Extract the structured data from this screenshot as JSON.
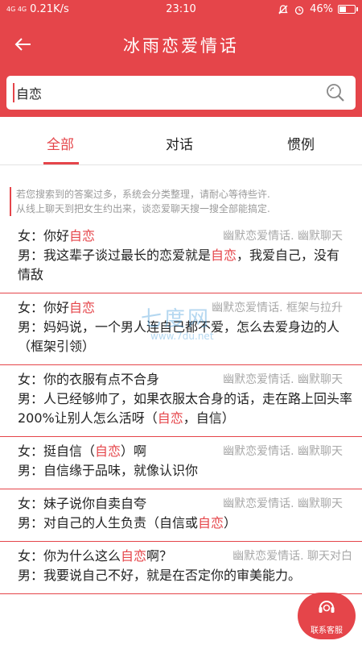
{
  "status_bar": {
    "signal": "4G 4G",
    "speed": "0.21K/s",
    "time": "23:10",
    "battery": "46%",
    "battery_level": 0.46
  },
  "header": {
    "title": "冰雨恋爱情话"
  },
  "search": {
    "value": "自恋"
  },
  "tabs": [
    {
      "label": "全部",
      "active": true
    },
    {
      "label": "对话",
      "active": false
    },
    {
      "label": "惯例",
      "active": false
    }
  ],
  "notice": {
    "line1": "若您搜索到的答案过多，系统会分类整理，请耐心等待些许.",
    "line2": "从线上聊天到把女生约出来，谈恋爱聊天搜一搜全部能搞定."
  },
  "items": [
    {
      "q_pre": "女：你好",
      "q_hl": "自恋",
      "q_post": "",
      "tag": "幽默恋爱情话. 幽默聊天",
      "a_pre": "男：我这辈子谈过最长的恋爱就是",
      "a_hl": "自恋",
      "a_post": "，我爱自己，没有情敌"
    },
    {
      "q_pre": "女：你好",
      "q_hl": "自恋",
      "q_post": "",
      "tag": "幽默恋爱情话. 框架与拉升",
      "a_pre": "男：妈妈说，一个男人连自己都不爱，怎么去爱身边的人（框架引领）",
      "a_hl": "",
      "a_post": ""
    },
    {
      "q_pre": "女：你的衣服有点不合身",
      "q_hl": "",
      "q_post": "",
      "tag": "幽默恋爱情话. 幽默聊天",
      "a_pre": "男：人已经够帅了，如果衣服太合身的话，走在路上回头率200%让别人怎么活呀（",
      "a_hl": "自恋",
      "a_post": "，自信）"
    },
    {
      "q_pre": "女：挺自信（",
      "q_hl": "自恋",
      "q_post": "）啊",
      "tag": "幽默恋爱情话. 幽默聊天",
      "a_pre": "男：自信缘于品味，就像认识你",
      "a_hl": "",
      "a_post": ""
    },
    {
      "q_pre": "女：妹子说你自卖自夸",
      "q_hl": "",
      "q_post": "",
      "tag": "幽默恋爱情话. 幽默聊天",
      "a_pre": "男：对自己的人生负责（自信或",
      "a_hl": "自恋",
      "a_post": "）"
    },
    {
      "q_pre": "女：你为什么这么",
      "q_hl": "自恋",
      "q_post": "啊？",
      "tag": "幽默恋爱情话. 聊天对白",
      "a_pre": "男：我要说自己不好，就是在否定你的审美能力。",
      "a_hl": "",
      "a_post": ""
    }
  ],
  "fab": {
    "label": "联系客服"
  },
  "watermark": {
    "logo": "七度网",
    "url": "www.7du.net"
  },
  "colors": {
    "accent": "#e5454a",
    "muted": "#a8a8a8"
  }
}
